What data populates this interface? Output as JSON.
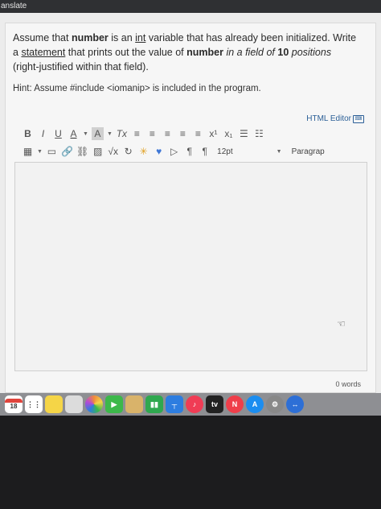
{
  "topbar": {
    "text": "anslate"
  },
  "question": {
    "p1": "Assume that ",
    "number1": "number",
    "p2": " is an ",
    "int": "int",
    "p3": " variable that has already been initialized. Write a ",
    "statement": "statement",
    "p4": " that prints out the value of ",
    "number2": "number",
    "p5": " in a field of ",
    "ten": "10",
    "p6": " positions",
    "p7": " (right-justified within that field)."
  },
  "hint": "Hint: Assume #include <iomanip> is included in the program.",
  "editor": {
    "html_editor_label": "HTML Editor",
    "toolbar1": [
      "B",
      "I",
      "U",
      "A",
      "A",
      "Tx",
      "≡",
      "≡",
      "≡",
      "≡",
      "≡",
      "x¹",
      "x₁",
      "☰",
      "☷"
    ],
    "toolbar2": [
      "▦",
      "▭",
      "🔗",
      "⛓",
      "▨",
      "√x",
      "↻",
      "✳",
      "♥",
      "▷",
      "¶",
      "¶"
    ],
    "font_size": "12pt",
    "paragraph": "Paragrap",
    "word_count": "0 words"
  },
  "dock": {
    "calendar_day": "18",
    "icons": [
      {
        "name": "calendar-icon",
        "color": "#ffffff"
      },
      {
        "name": "reminders-icon",
        "color": "#ffffff"
      },
      {
        "name": "notes-icon",
        "color": "#f5d547"
      },
      {
        "name": "photos-app-icon",
        "color": "#dcdcdc"
      },
      {
        "name": "photos-icon",
        "color": "#f08a3c"
      },
      {
        "name": "facetime-icon",
        "color": "#3cb84a"
      },
      {
        "name": "notes-pad-icon",
        "color": "#d9b36a"
      },
      {
        "name": "numbers-icon",
        "color": "#2fa84f"
      },
      {
        "name": "keynote-icon",
        "color": "#2d7de0"
      },
      {
        "name": "music-icon",
        "color": "#f03c55"
      },
      {
        "name": "apple-tv-icon",
        "color": "#222222"
      },
      {
        "name": "news-icon",
        "color": "#ef3e4a"
      },
      {
        "name": "app-store-icon",
        "color": "#1b8df0"
      },
      {
        "name": "system-preferences-icon",
        "color": "#888888"
      },
      {
        "name": "migration-icon",
        "color": "#2d6fd6"
      }
    ],
    "tv_label": "tv"
  }
}
